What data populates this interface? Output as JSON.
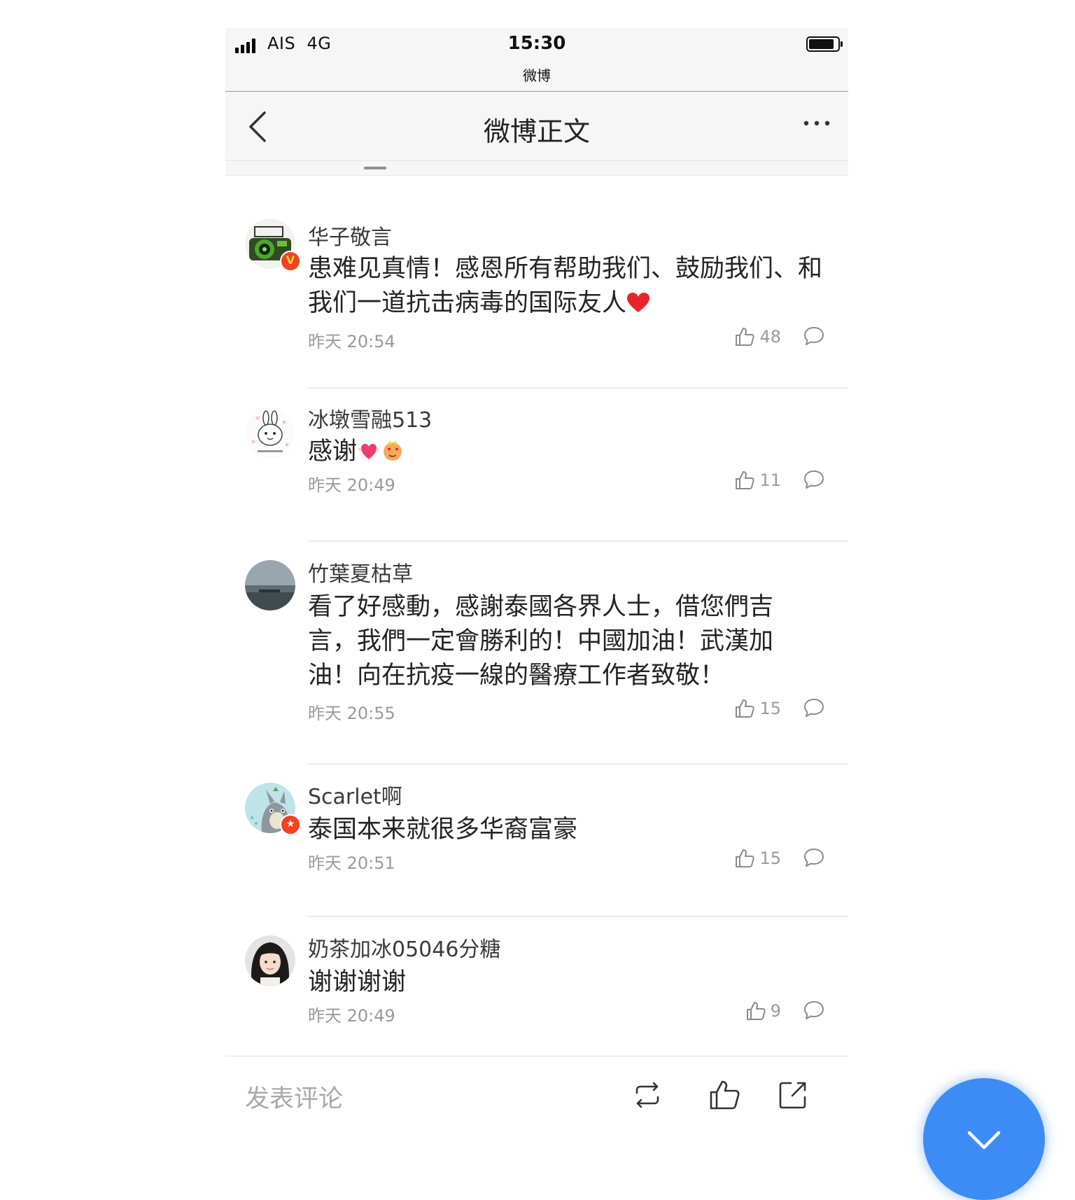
{
  "status_bar": {
    "carrier": "AIS",
    "network": "4G",
    "time": "15:30",
    "app": "微博"
  },
  "nav": {
    "title": "微博正文",
    "back_icon": "chevron-left-icon",
    "more_icon": "more-dots-icon"
  },
  "comments": [
    {
      "username": "华子敬言",
      "content": "患难见真情！感恩所有帮助我们、鼓励我们、和我们一道抗击病毒的国际友人",
      "emoji": [
        "red-heart"
      ],
      "time": "昨天 20:54",
      "likes": "48",
      "badge": "V"
    },
    {
      "username": "冰墩雪融513",
      "content": "感谢",
      "emoji": [
        "heart-with-wings",
        "heart-eyes-face"
      ],
      "time": "昨天 20:49",
      "likes": "11"
    },
    {
      "username": "竹葉夏枯草",
      "content": "看了好感動，感謝泰國各界人士，借您們吉言，我們一定會勝利的！中國加油！武漢加油！向在抗疫一線的醫療工作者致敬！",
      "time": "昨天 20:55",
      "likes": "15"
    },
    {
      "username": "Scarlet啊",
      "content": "泰国本来就很多华裔富豪",
      "time": "昨天 20:51",
      "likes": "15",
      "badge": "★"
    },
    {
      "username": "奶茶加冰05046分糖",
      "content": "谢谢谢谢",
      "time": "昨天 20:49",
      "likes": "9"
    }
  ],
  "bottom_bar": {
    "placeholder": "发表评论",
    "icons": [
      "repost-icon",
      "like-icon",
      "share-icon"
    ]
  },
  "colors": {
    "accent": "#3d8cf5",
    "badge": "#f2431e",
    "meta": "#9a9a9a"
  }
}
